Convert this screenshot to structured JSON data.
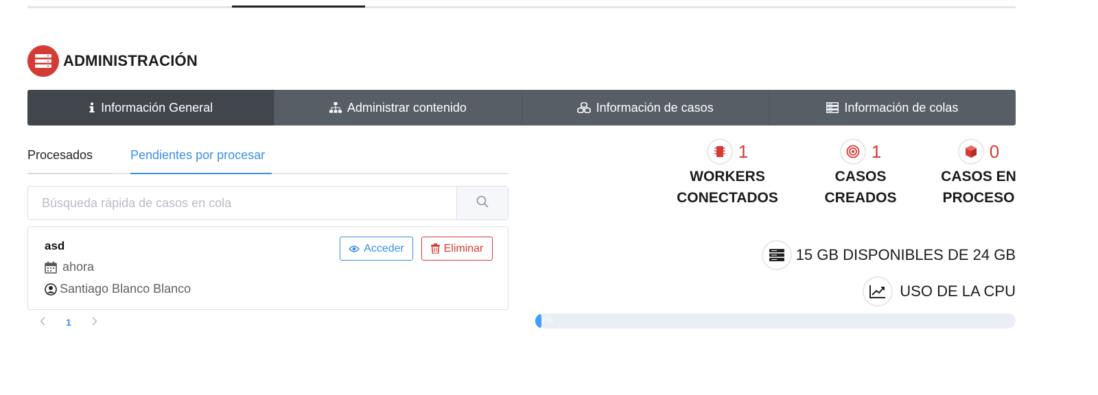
{
  "header": {
    "title": "ADMINISTRACIÓN",
    "logo_icon": "server-icon"
  },
  "main_tabs": [
    {
      "label": "Información General",
      "icon": "info-icon",
      "active": true
    },
    {
      "label": "Administrar contenido",
      "icon": "sitemap-icon"
    },
    {
      "label": "Información de casos",
      "icon": "cubes-icon"
    },
    {
      "label": "Información de colas",
      "icon": "server-icon"
    }
  ],
  "sub_tabs": [
    {
      "label": "Procesados"
    },
    {
      "label": "Pendientes por procesar",
      "active": true
    }
  ],
  "search": {
    "placeholder": "Búsqueda rápida de casos en cola",
    "value": ""
  },
  "case": {
    "name": "asd",
    "time": "ahora",
    "user": "Santiago Blanco Blanco",
    "access_label": "Acceder",
    "delete_label": "Eliminar"
  },
  "pagination": {
    "current": "1"
  },
  "stats": [
    {
      "value": "1",
      "line1": "WORKERS",
      "line2": "CONECTADOS",
      "icon": "chip-icon"
    },
    {
      "value": "1",
      "line1": "CASOS",
      "line2": "CREADOS",
      "icon": "target-icon"
    },
    {
      "value": "0",
      "line1": "CASOS EN",
      "line2": "PROCESO",
      "icon": "box-icon"
    }
  ],
  "disk": {
    "text": "15 GB DISPONIBLES DE 24 GB"
  },
  "cpu": {
    "label": "USO DE LA CPU",
    "percent": 1,
    "percent_label": "1%"
  },
  "colors": {
    "accent_red": "#d63a34",
    "accent_blue": "#3a8ee6",
    "tab_bg": "#585e66",
    "tab_active_bg": "#41464d"
  }
}
